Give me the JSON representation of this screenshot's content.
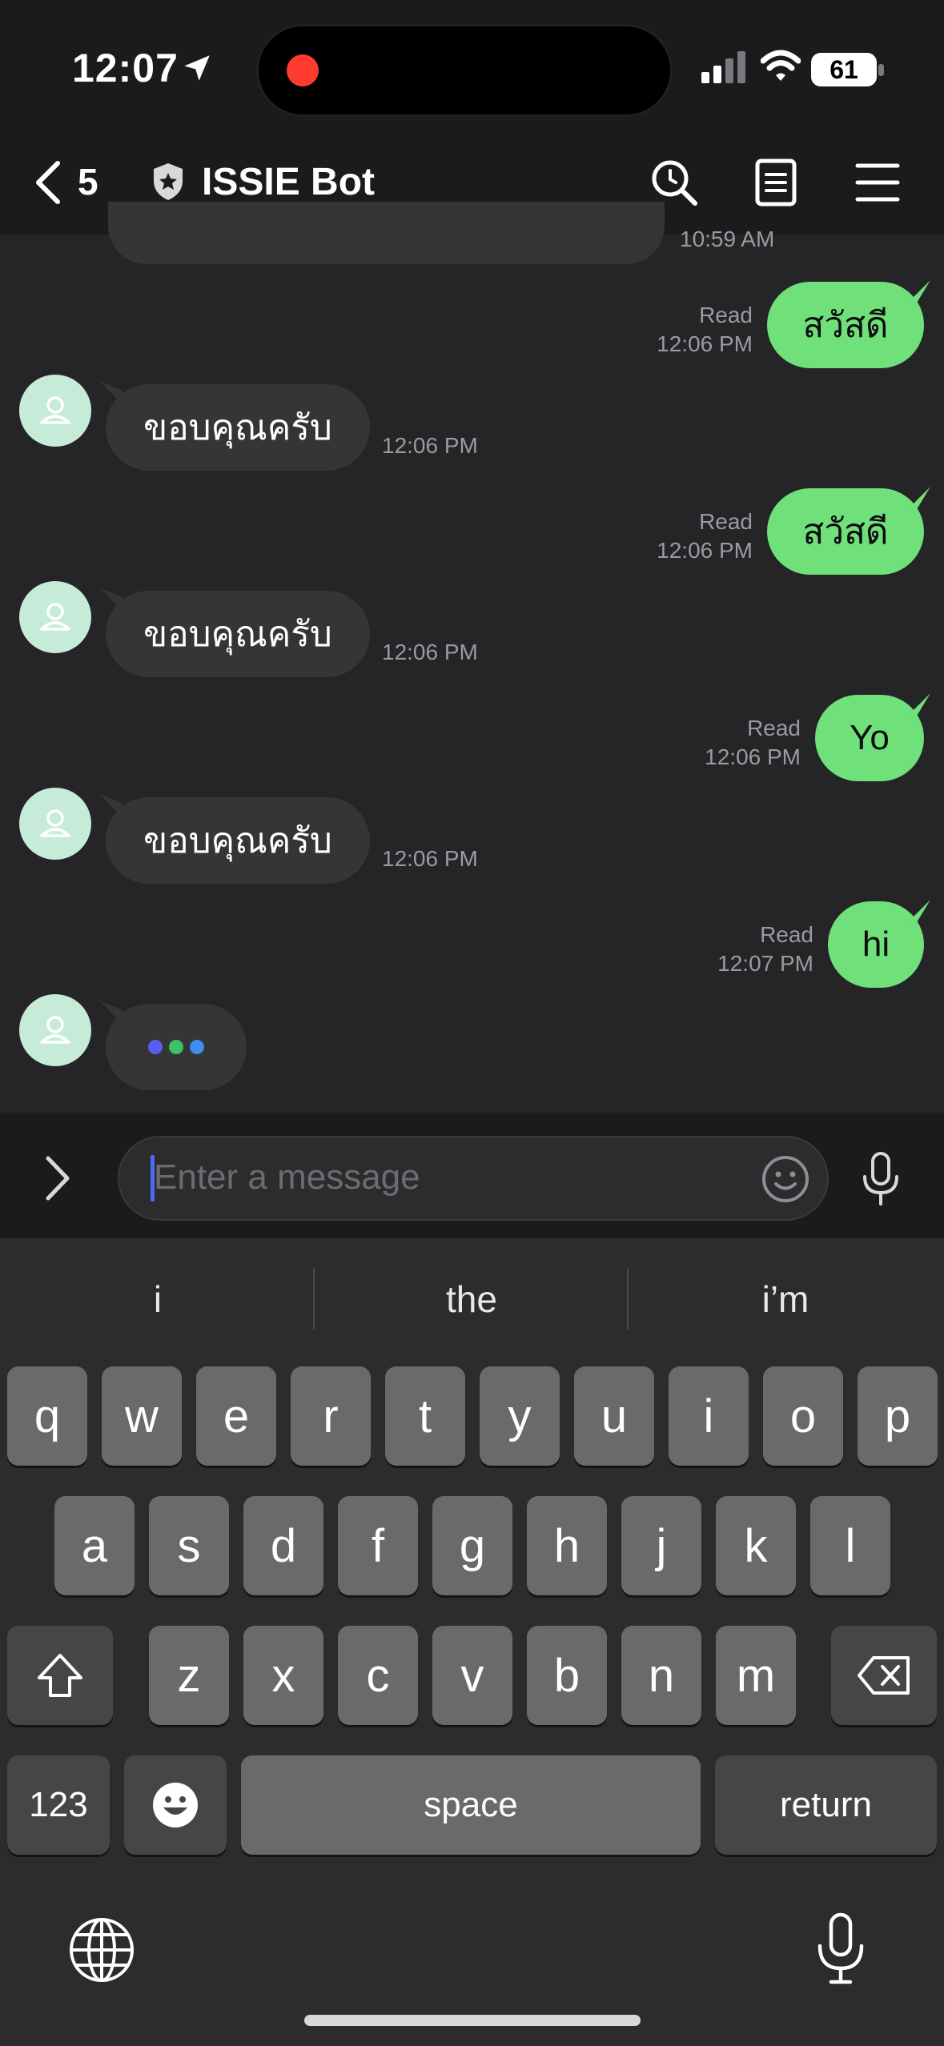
{
  "status_bar": {
    "time": "12:07",
    "battery": "61",
    "location_icon": "location-arrow-icon",
    "signal_icon": "cellular-signal-icon",
    "wifi_icon": "wifi-icon"
  },
  "header": {
    "back_count": "5",
    "title": "ISSIE Bot",
    "icons": [
      "back-chevron-icon",
      "shield-star-icon",
      "search-icon",
      "notes-icon",
      "menu-icon"
    ]
  },
  "messages": {
    "prev_time": "10:59 AM",
    "m1": {
      "text": "สวัสดี",
      "status": "Read",
      "time": "12:06 PM"
    },
    "r1": {
      "text": "ขอบคุณครับ",
      "time": "12:06 PM"
    },
    "m2": {
      "text": "สวัสดี",
      "status": "Read",
      "time": "12:06 PM"
    },
    "r2": {
      "text": "ขอบคุณครับ",
      "time": "12:06 PM"
    },
    "m3": {
      "text": "Yo",
      "status": "Read",
      "time": "12:06 PM"
    },
    "r3": {
      "text": "ขอบคุณครับ",
      "time": "12:06 PM"
    },
    "m4": {
      "text": "hi",
      "status": "Read",
      "time": "12:07 PM"
    },
    "typing_colors": [
      "#5b5cf0",
      "#3cc163",
      "#3d8ef0"
    ]
  },
  "input": {
    "placeholder": "Enter a message"
  },
  "keyboard": {
    "suggestions": [
      "i",
      "the",
      "i’m"
    ],
    "row1": [
      "q",
      "w",
      "e",
      "r",
      "t",
      "y",
      "u",
      "i",
      "o",
      "p"
    ],
    "row2": [
      "a",
      "s",
      "d",
      "f",
      "g",
      "h",
      "j",
      "k",
      "l"
    ],
    "row3": [
      "z",
      "x",
      "c",
      "v",
      "b",
      "n",
      "m"
    ],
    "numbers_label": "123",
    "space_label": "space",
    "return_label": "return"
  },
  "colors": {
    "outgoing_bubble": "#6fe07a",
    "incoming_bubble": "#353537",
    "avatar": "#c6ecd9"
  }
}
